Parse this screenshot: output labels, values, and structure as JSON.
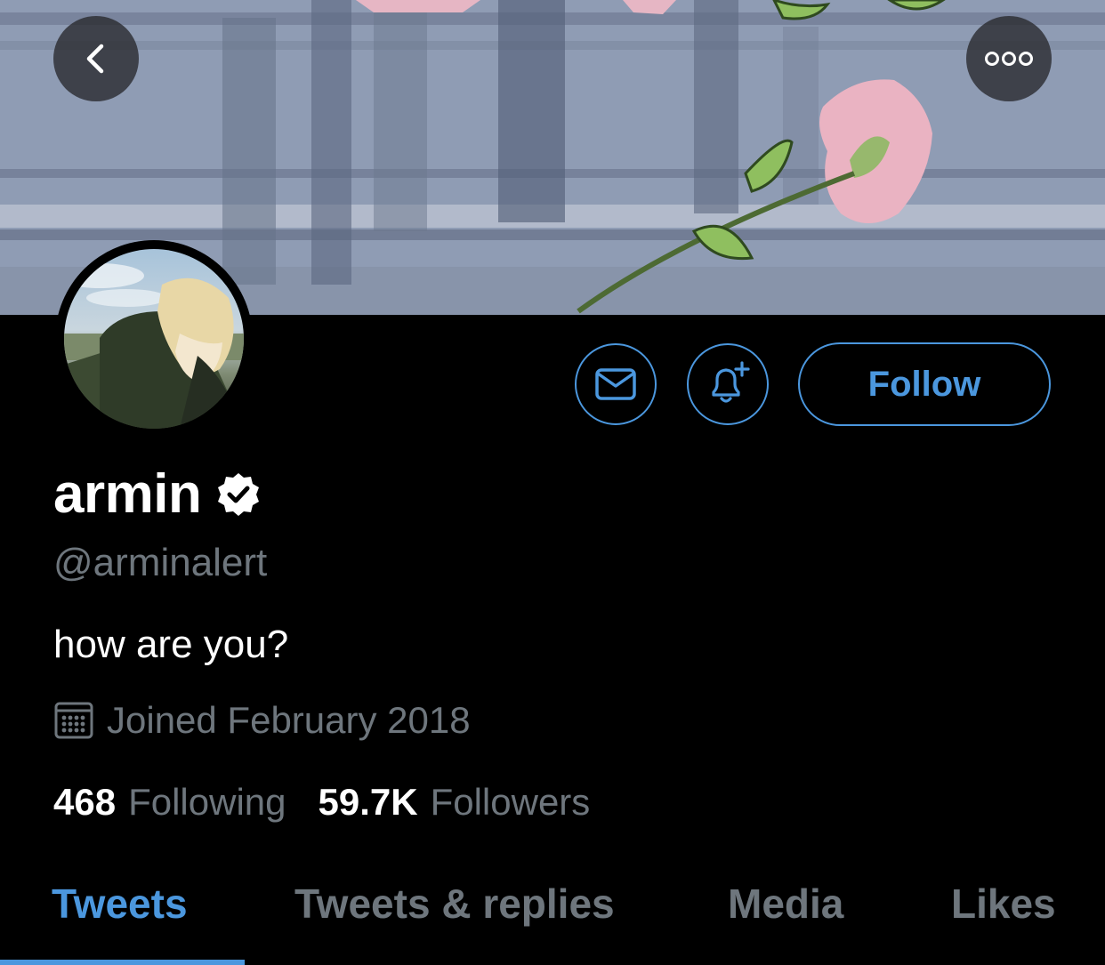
{
  "header": {
    "back_icon": "chevron-left-icon",
    "more_icon": "more-horizontal-icon"
  },
  "profile": {
    "name": "armin",
    "verified": true,
    "handle": "@arminalert",
    "bio": "how are you?",
    "joined": "Joined February 2018",
    "following_count": "468",
    "following_label": "Following",
    "followers_count": "59.7K",
    "followers_label": "Followers"
  },
  "actions": {
    "message_icon": "mail-icon",
    "notify_icon": "bell-plus-icon",
    "follow_label": "Follow"
  },
  "tabs": [
    {
      "label": "Tweets",
      "active": true
    },
    {
      "label": "Tweets & replies",
      "active": false
    },
    {
      "label": "Media",
      "active": false
    },
    {
      "label": "Likes",
      "active": false
    }
  ],
  "colors": {
    "accent": "#4b97de",
    "muted": "#6e767d",
    "background": "#000000"
  }
}
